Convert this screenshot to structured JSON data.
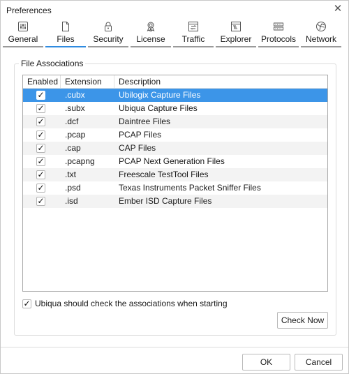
{
  "window": {
    "title": "Preferences",
    "close_icon": "close-icon"
  },
  "tabs": [
    {
      "label": "General",
      "icon": "sliders-icon",
      "active": false
    },
    {
      "label": "Files",
      "icon": "file-icon",
      "active": true
    },
    {
      "label": "Security",
      "icon": "lock-icon",
      "active": false
    },
    {
      "label": "License",
      "icon": "award-ribbon-icon",
      "active": false
    },
    {
      "label": "Traffic",
      "icon": "traffic-window-icon",
      "active": false
    },
    {
      "label": "Explorer",
      "icon": "explorer-tree-icon",
      "active": false
    },
    {
      "label": "Protocols",
      "icon": "protocols-stack-icon",
      "active": false
    },
    {
      "label": "Network",
      "icon": "network-globe-icon",
      "active": false
    }
  ],
  "group": {
    "title": "File Associations"
  },
  "table": {
    "columns": [
      "Enabled",
      "Extension",
      "Description"
    ],
    "rows": [
      {
        "enabled": true,
        "extension": ".cubx",
        "description": "Ubilogix Capture Files",
        "selected": true
      },
      {
        "enabled": true,
        "extension": ".subx",
        "description": "Ubiqua Capture Files",
        "selected": false
      },
      {
        "enabled": true,
        "extension": ".dcf",
        "description": "Daintree Files",
        "selected": false
      },
      {
        "enabled": true,
        "extension": ".pcap",
        "description": "PCAP Files",
        "selected": false
      },
      {
        "enabled": true,
        "extension": ".cap",
        "description": "CAP Files",
        "selected": false
      },
      {
        "enabled": true,
        "extension": ".pcapng",
        "description": "PCAP Next Generation Files",
        "selected": false
      },
      {
        "enabled": true,
        "extension": ".txt",
        "description": "Freescale TestTool Files",
        "selected": false
      },
      {
        "enabled": true,
        "extension": ".psd",
        "description": "Texas Instruments Packet Sniffer Files",
        "selected": false
      },
      {
        "enabled": true,
        "extension": ".isd",
        "description": "Ember ISD Capture Files",
        "selected": false
      }
    ]
  },
  "options": {
    "check_on_start_label": "Ubiqua should check the associations when starting",
    "check_on_start": true
  },
  "buttons": {
    "check_now": "Check Now",
    "ok": "OK",
    "cancel": "Cancel"
  },
  "glyphs": {
    "check": "✓",
    "close": "✕"
  },
  "colors": {
    "accent": "#2f8be0",
    "selection": "#3c95e8"
  }
}
